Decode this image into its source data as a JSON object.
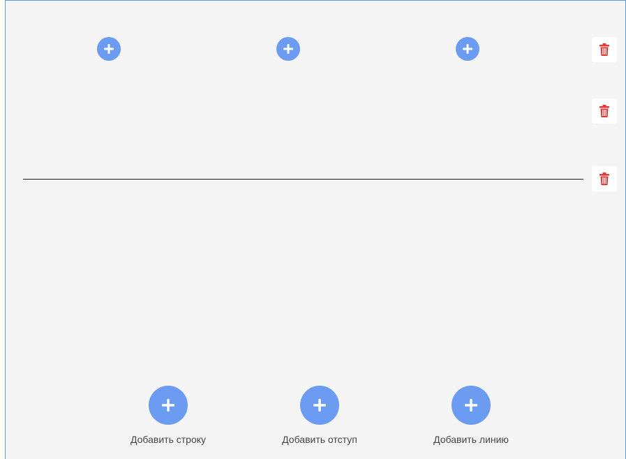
{
  "row_controls": {
    "add_column_icon": "plus-icon",
    "delete_icon": "trash-icon",
    "delete_color": "#e53935",
    "accent_color": "#6b9cf2"
  },
  "footer_actions": [
    {
      "label": "Добавить строку",
      "icon": "plus-icon"
    },
    {
      "label": "Добавить отступ",
      "icon": "plus-icon"
    },
    {
      "label": "Добавить линию",
      "icon": "plus-icon"
    }
  ]
}
